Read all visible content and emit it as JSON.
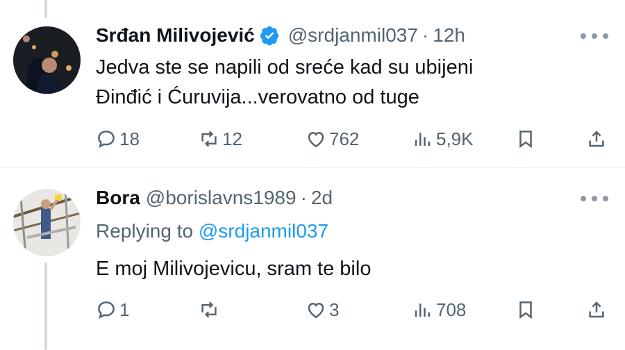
{
  "tweets": [
    {
      "name": "Srđan Milivojević",
      "verified": true,
      "handle": "@srdjanmil037",
      "time": "12h",
      "text": "Jedva ste se napili od sreće kad su ubijeni\nĐinđić i Ćuruvija...verovatno od tuge",
      "replies": "18",
      "retweets": "12",
      "likes": "762",
      "views": "5,9K"
    },
    {
      "name": "Bora",
      "verified": false,
      "handle": "@borislavns1989",
      "time": "2d",
      "replying_label": "Replying to",
      "replying_to": "@srdjanmil037",
      "text": "E moj Milivojevicu, sram te bilo",
      "replies": "1",
      "retweets": "",
      "likes": "3",
      "views": "708"
    }
  ],
  "colors": {
    "accent": "#1d9bf0",
    "secondary_text": "#536471",
    "thread_line": "#cfd9de"
  },
  "icons": [
    "reply-icon",
    "retweet-icon",
    "like-icon",
    "views-icon",
    "bookmark-icon",
    "share-icon",
    "more-icon",
    "verified-badge-icon"
  ]
}
